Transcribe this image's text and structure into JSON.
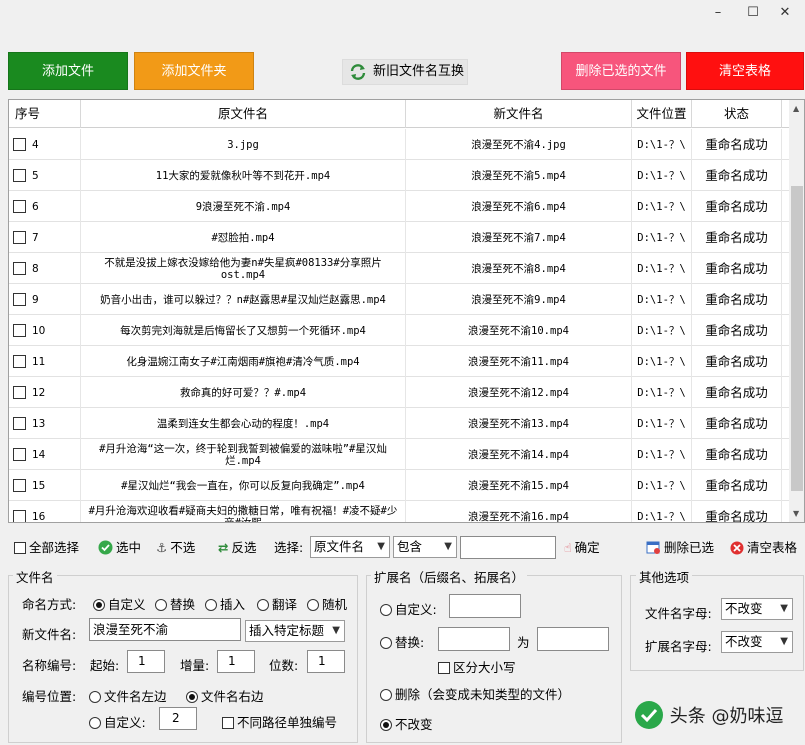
{
  "window": {
    "minimize": "–",
    "maximize": "☐",
    "close": "✕"
  },
  "toolbar": {
    "add_file": "添加文件",
    "add_folder": "添加文件夹",
    "swap_names": "新旧文件名互换",
    "delete_selected": "删除已选的文件",
    "clear_table": "清空表格",
    "colors": {
      "add_file": "#1a8a1f",
      "add_folder": "#f29a17",
      "delete_selected": "#f7557c",
      "clear_table": "#ff1010"
    }
  },
  "table": {
    "headers": [
      "序号",
      "原文件名",
      "新文件名",
      "文件位置",
      "状态"
    ],
    "rows": [
      {
        "idx": "4",
        "orig": "3.jpg",
        "new": "浪漫至死不渝4.jpg",
        "loc": "D:\\1-？\\",
        "status": "重命名成功"
      },
      {
        "idx": "5",
        "orig": "11大家的爱就像秋叶等不到花开.mp4",
        "new": "浪漫至死不渝5.mp4",
        "loc": "D:\\1-？\\",
        "status": "重命名成功"
      },
      {
        "idx": "6",
        "orig": "9浪漫至死不渝.mp4",
        "new": "浪漫至死不渝6.mp4",
        "loc": "D:\\1-？\\",
        "status": "重命名成功"
      },
      {
        "idx": "7",
        "orig": "#怼脸拍.mp4",
        "new": "浪漫至死不渝7.mp4",
        "loc": "D:\\1-？\\",
        "status": "重命名成功"
      },
      {
        "idx": "8",
        "orig": "不就是没拔上嫁衣没嫁给他为妻n#失星疯#08133#分享照片ost.mp4",
        "new": "浪漫至死不渝8.mp4",
        "loc": "D:\\1-？\\",
        "status": "重命名成功"
      },
      {
        "idx": "9",
        "orig": "奶音小出击，谁可以躲过？？n#赵露思#星汉灿烂赵露思.mp4",
        "new": "浪漫至死不渝9.mp4",
        "loc": "D:\\1-？\\",
        "status": "重命名成功"
      },
      {
        "idx": "10",
        "orig": "每次剪完刘海就是后悔留长了又想剪一个死循环.mp4",
        "new": "浪漫至死不渝10.mp4",
        "loc": "D:\\1-？\\",
        "status": "重命名成功"
      },
      {
        "idx": "11",
        "orig": "化身温婉江南女子#江南烟雨#旗袍#清冷气质.mp4",
        "new": "浪漫至死不渝11.mp4",
        "loc": "D:\\1-？\\",
        "status": "重命名成功"
      },
      {
        "idx": "12",
        "orig": "救命真的好可爱？？#.mp4",
        "new": "浪漫至死不渝12.mp4",
        "loc": "D:\\1-？\\",
        "status": "重命名成功"
      },
      {
        "idx": "13",
        "orig": "温柔到连女生都会心动的程度！.mp4",
        "new": "浪漫至死不渝13.mp4",
        "loc": "D:\\1-？\\",
        "status": "重命名成功"
      },
      {
        "idx": "14",
        "orig": "#月升沧海“这一次，终于轮到我誓到被偏爱的滋味啦”#星汉灿烂.mp4",
        "new": "浪漫至死不渝14.mp4",
        "loc": "D:\\1-？\\",
        "status": "重命名成功"
      },
      {
        "idx": "15",
        "orig": "#星汉灿烂“我会一直在，你可以反复向我确定”.mp4",
        "new": "浪漫至死不渝15.mp4",
        "loc": "D:\\1-？\\",
        "status": "重命名成功"
      },
      {
        "idx": "16",
        "orig": "#月升沧海欢迎收看#疑商夫妇的撒糖日常，唯有祝福！#凌不疑#少商#汝熙",
        "new": "浪漫至死不渝16.mp4",
        "loc": "D:\\1-？\\",
        "status": "重命名成功"
      }
    ]
  },
  "selection": {
    "select_all": "全部选择",
    "select": "选中",
    "deselect": "不选",
    "invert": "反选",
    "select_label": "选择:",
    "field_combo": "原文件名",
    "mode_combo": "包含",
    "filter_value": "",
    "confirm": "确定",
    "delete_selected": "删除已选",
    "clear_table": "清空表格"
  },
  "filename_group": {
    "title": "文件名",
    "mode_label": "命名方式:",
    "modes": [
      "自定义",
      "替换",
      "插入",
      "翻译",
      "随机"
    ],
    "new_name_label": "新文件名:",
    "new_name_value": "浪漫至死不渝",
    "insert_combo": "插入特定标题",
    "numbering_label": "名称编号:",
    "start_label": "起始:",
    "start_value": "1",
    "step_label": "增量:",
    "step_value": "1",
    "digits_label": "位数:",
    "digits_value": "1",
    "position_label": "编号位置:",
    "pos_left": "文件名左边",
    "pos_right": "文件名右边",
    "pos_custom": "自定义:",
    "pos_custom_value": "2",
    "separate_numbering": "不同路径单独编号"
  },
  "ext_group": {
    "title": "扩展名（后缀名、拓展名）",
    "custom": "自定义:",
    "replace": "替换:",
    "to": "为",
    "case_sensitive": "区分大小写",
    "delete": "删除（会变成未知类型的文件）",
    "unchanged": "不改变"
  },
  "other_group": {
    "title": "其他选项",
    "filename_case_label": "文件名字母:",
    "filename_case_value": "不改变",
    "ext_case_label": "扩展名字母:",
    "ext_case_value": "不改变"
  },
  "watermark": "头条 @奶味逗"
}
